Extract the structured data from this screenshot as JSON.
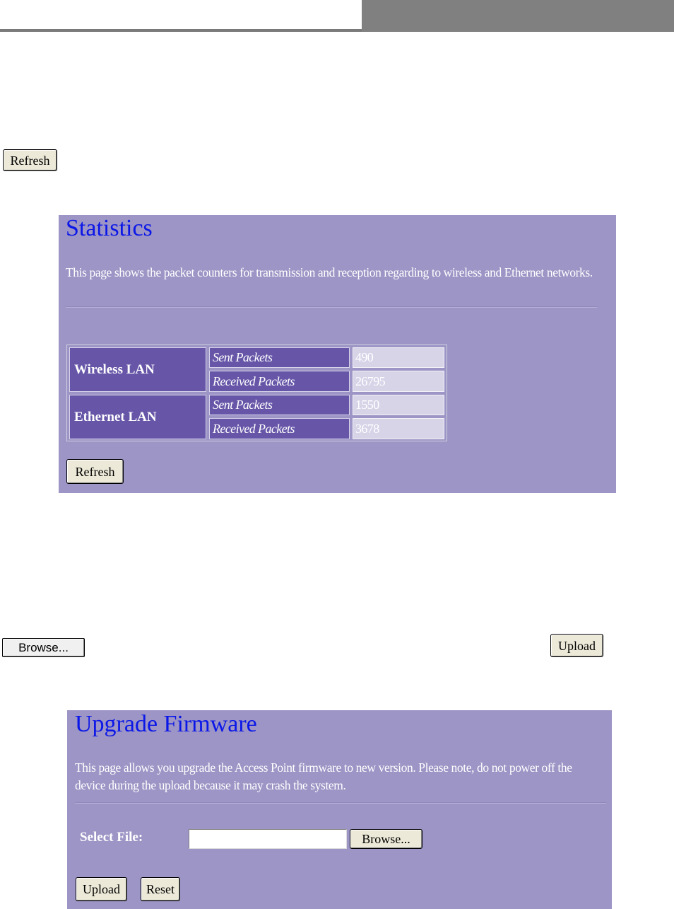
{
  "top_controls": {
    "refresh_label": "Refresh",
    "browse_label": "Browse...",
    "upload_label": "Upload"
  },
  "statistics": {
    "title": "Statistics",
    "description": "This page shows the packet counters for transmission and reception regarding to wireless and Ethernet networks.",
    "rows": [
      {
        "group": "Wireless LAN",
        "metrics": [
          {
            "label": "Sent Packets",
            "value": "490"
          },
          {
            "label": "Received Packets",
            "value": "26795"
          }
        ]
      },
      {
        "group": "Ethernet LAN",
        "metrics": [
          {
            "label": "Sent Packets",
            "value": "1550"
          },
          {
            "label": "Received Packets",
            "value": "3678"
          }
        ]
      }
    ],
    "refresh_label": "Refresh"
  },
  "upgrade": {
    "title": "Upgrade Firmware",
    "description": "This page allows you upgrade the Access Point firmware to new version. Please note, do not power off the device during the upload because it may crash the system.",
    "select_file_label": "Select File:",
    "file_value": "",
    "browse_label": "Browse...",
    "upload_label": "Upload",
    "reset_label": "Reset"
  }
}
